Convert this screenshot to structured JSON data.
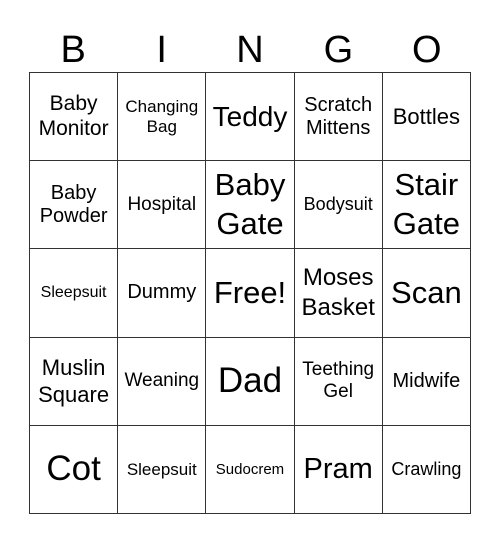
{
  "header": [
    "B",
    "I",
    "N",
    "G",
    "O"
  ],
  "cells": [
    "Baby Monitor",
    "Changing Bag",
    "Teddy",
    "Scratch Mittens",
    "Bottles",
    "Baby Powder",
    "Hospital",
    "Baby Gate",
    "Bodysuit",
    "Stair Gate",
    "Sleepsuit",
    "Dummy",
    "Free!",
    "Moses Basket",
    "Scan",
    "Muslin Square",
    "Weaning",
    "Dad",
    "Teething Gel",
    "Midwife",
    "Cot",
    "Sleepsuit",
    "Sudocrem",
    "Pram",
    "Crawling"
  ]
}
